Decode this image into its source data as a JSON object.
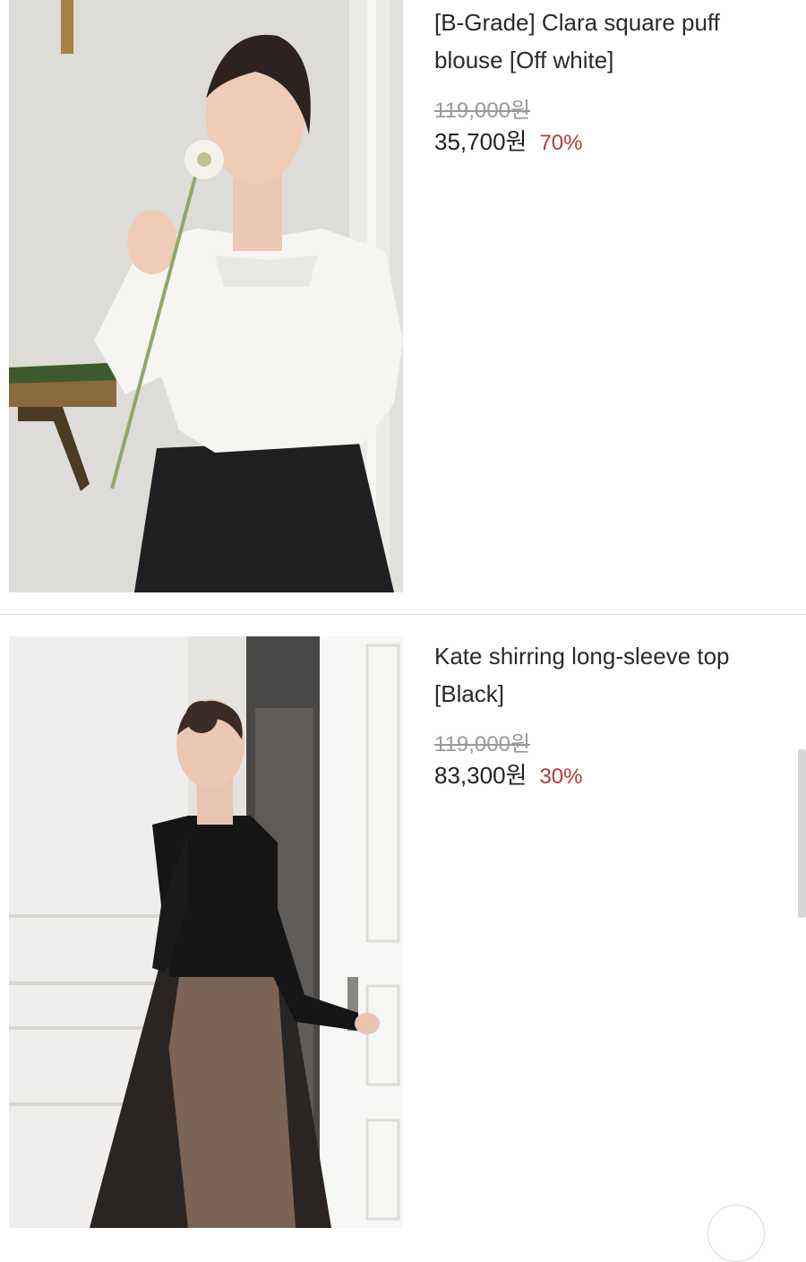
{
  "products": [
    {
      "name": "[B-Grade] Clara square puff blouse [Off white]",
      "original_price": "119,000원",
      "sale_price": "35,700원",
      "discount": "70%"
    },
    {
      "name": "Kate shirring long-sleeve top [Black]",
      "original_price": "119,000원",
      "sale_price": "83,300원",
      "discount": "30%"
    }
  ],
  "colors": {
    "discount": "#b13a3a",
    "original_price": "#9a9a9a",
    "divider": "#e2e2e2"
  },
  "icons": [
    "scroll-to-top-icon"
  ]
}
